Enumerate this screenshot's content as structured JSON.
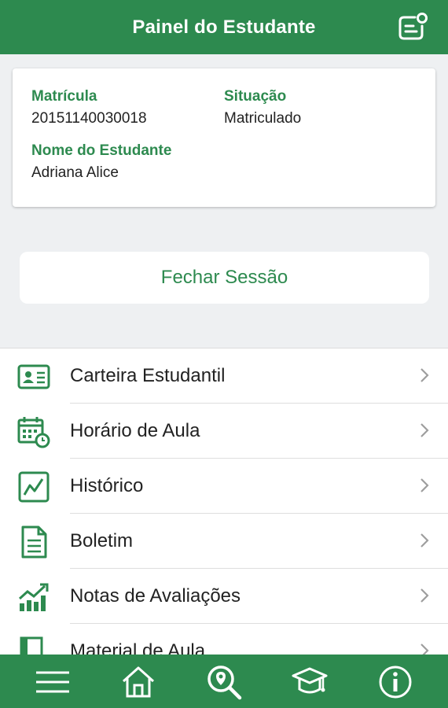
{
  "header": {
    "title": "Painel do Estudante",
    "messages_icon": "message-notification-icon"
  },
  "student": {
    "matricula_label": "Matrícula",
    "matricula": "20151140030018",
    "situacao_label": "Situação",
    "situacao": "Matriculado",
    "nome_label": "Nome do Estudante",
    "nome": "Adriana Alice"
  },
  "logout_label": "Fechar Sessão",
  "menu": [
    {
      "label": "Carteira Estudantil",
      "icon": "id-card-icon"
    },
    {
      "label": "Horário de Aula",
      "icon": "calendar-clock-icon"
    },
    {
      "label": "Histórico",
      "icon": "chart-history-icon"
    },
    {
      "label": "Boletim",
      "icon": "document-icon"
    },
    {
      "label": "Notas de Avaliações",
      "icon": "growth-chart-icon"
    },
    {
      "label": "Material de Aula",
      "icon": "book-icon"
    }
  ],
  "bottom_nav": [
    "menu-icon",
    "home-icon",
    "search-location-icon",
    "graduation-cap-icon",
    "info-icon"
  ],
  "colors": {
    "primary": "#2d8a4f",
    "background": "#eef0f2"
  }
}
